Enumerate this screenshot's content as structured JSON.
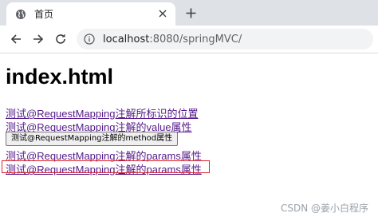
{
  "browser": {
    "tab_title": "首页",
    "url_host": "localhost",
    "url_rest": ":8080/springMVC/"
  },
  "page": {
    "heading": "index.html",
    "link1": "测试@RequestMapping注解所标识的位置",
    "link2": "测试@RequestMapping注解的value属性",
    "method_button": "测试@RequestMapping注解的method属性",
    "link3": "测试@RequestMapping注解的params属性",
    "link4": "测试@RequestMapping注解的params属性"
  },
  "watermark": "CSDN @姜小白程序",
  "colors": {
    "link": "#551a8b",
    "highlight_border": "#e0242c",
    "tabbar": "#dee1e6"
  },
  "icons": {
    "tab_favicon": "globe-icon",
    "tab_close": "close-icon",
    "new_tab": "plus-icon",
    "back": "arrow-left-icon",
    "forward": "arrow-right-icon",
    "reload": "reload-icon",
    "site_info": "info-icon"
  }
}
